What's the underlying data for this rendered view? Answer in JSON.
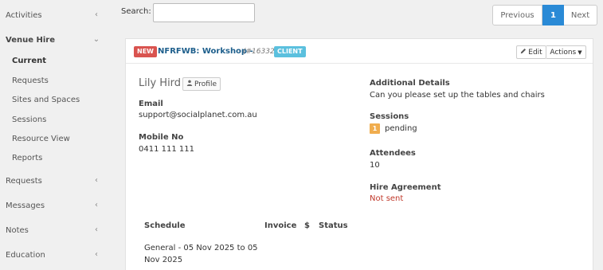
{
  "sidebar": {
    "activities": "Activities",
    "venue_hire": "Venue Hire",
    "venue_items": {
      "current": "Current",
      "requests": "Requests",
      "sites": "Sites and Spaces",
      "sessions": "Sessions",
      "resource_view": "Resource View",
      "reports": "Reports"
    },
    "requests": "Requests",
    "messages": "Messages",
    "notes": "Notes",
    "education": "Education"
  },
  "search": {
    "label": "Search:",
    "value": "",
    "placeholder": ""
  },
  "pagination": {
    "previous": "Previous",
    "page": "1",
    "next": "Next"
  },
  "card": {
    "new_badge": "NEW",
    "title": "NFRFWB: Workshop -",
    "ref": "(#16332)",
    "client_badge": "CLIENT",
    "edit_label": "Edit",
    "actions_label": "Actions",
    "contact_name": "Lily Hird",
    "profile_label": "Profile",
    "email_label": "Email",
    "email_value": "support@socialplanet.com.au",
    "mobile_label": "Mobile No",
    "mobile_value": "0411 111 111",
    "details_label": "Additional Details",
    "details_value": "Can you please set up the tables and chairs",
    "sessions_label": "Sessions",
    "sessions_count": "1",
    "sessions_status": "pending",
    "attendees_label": "Attendees",
    "attendees_value": "10",
    "agreement_label": "Hire Agreement",
    "agreement_value": "Not sent",
    "table": {
      "headers": {
        "schedule": "Schedule",
        "invoice": "Invoice",
        "dollar": "$",
        "status": "Status"
      },
      "rows": [
        {
          "schedule": "General - 05 Nov 2025 to 05 Nov 2025"
        }
      ]
    }
  },
  "colors": {
    "accent": "#2a8ad6",
    "new": "#d9534f",
    "client": "#5bc0de",
    "pending": "#f0ad4e",
    "not_sent": "#c0392b"
  }
}
